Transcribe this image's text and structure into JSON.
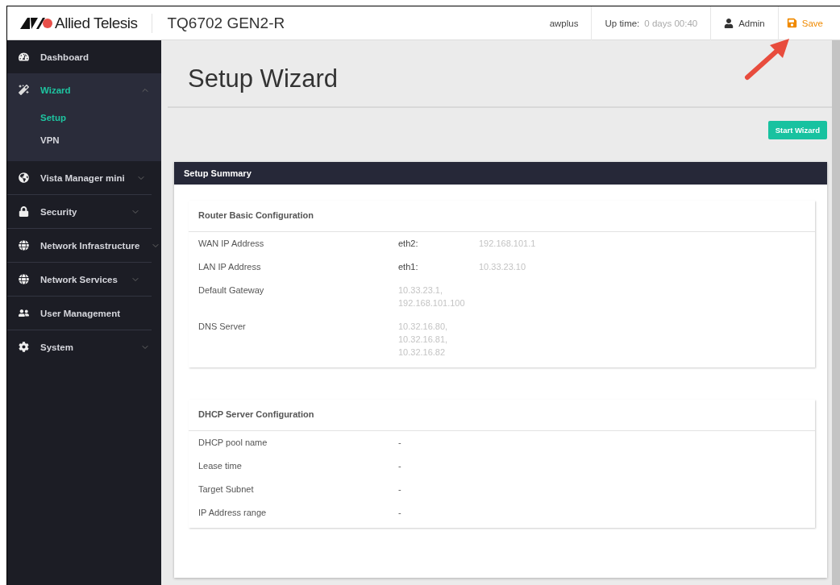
{
  "header": {
    "brand": "Allied Telesis",
    "device": "TQ6702 GEN2-R",
    "hostname": "awplus",
    "uptime_label": "Up time:",
    "uptime_value": "0 days 00:40",
    "user": "Admin",
    "save": "Save"
  },
  "sidebar": {
    "items": [
      {
        "label": "Dashboard",
        "kind": "link",
        "expanded": false
      },
      {
        "label": "Wizard",
        "kind": "menu",
        "expanded": true,
        "children": [
          {
            "label": "Setup",
            "selected": true
          },
          {
            "label": "VPN",
            "selected": false
          }
        ]
      },
      {
        "label": "Vista Manager mini",
        "kind": "menu",
        "expanded": false
      },
      {
        "label": "Security",
        "kind": "menu",
        "expanded": false
      },
      {
        "label": "Network Infrastructure",
        "kind": "menu",
        "expanded": false
      },
      {
        "label": "Network Services",
        "kind": "menu",
        "expanded": false
      },
      {
        "label": "User Management",
        "kind": "link",
        "expanded": false
      },
      {
        "label": "System",
        "kind": "menu",
        "expanded": false
      }
    ]
  },
  "page": {
    "title": "Setup Wizard",
    "start_button": "Start Wizard"
  },
  "summary": {
    "title": "Setup Summary",
    "sections": [
      {
        "title": "Router Basic Configuration",
        "rows": [
          {
            "label": "WAN IP Address",
            "port": "eth2:",
            "values": [
              "192.168.101.1"
            ],
            "blurred": true
          },
          {
            "label": "LAN IP Address",
            "port": "eth1:",
            "values": [
              "10.33.23.10"
            ],
            "blurred": true
          },
          {
            "label": "Default Gateway",
            "values": [
              "10.33.23.1,",
              "192.168.101.100"
            ],
            "blurred": true
          },
          {
            "label": "DNS Server",
            "values": [
              "10.32.16.80,",
              "10.32.16.81,",
              "10.32.16.82"
            ],
            "blurred": true
          }
        ]
      },
      {
        "title": "DHCP Server Configuration",
        "rows": [
          {
            "label": "DHCP pool name",
            "values": [
              "-"
            ],
            "blurred": false
          },
          {
            "label": "Lease time",
            "values": [
              "-"
            ],
            "blurred": false
          },
          {
            "label": "Target Subnet",
            "values": [
              "-"
            ],
            "blurred": false
          },
          {
            "label": "IP Address range",
            "values": [
              "-"
            ],
            "blurred": false
          }
        ]
      }
    ]
  }
}
